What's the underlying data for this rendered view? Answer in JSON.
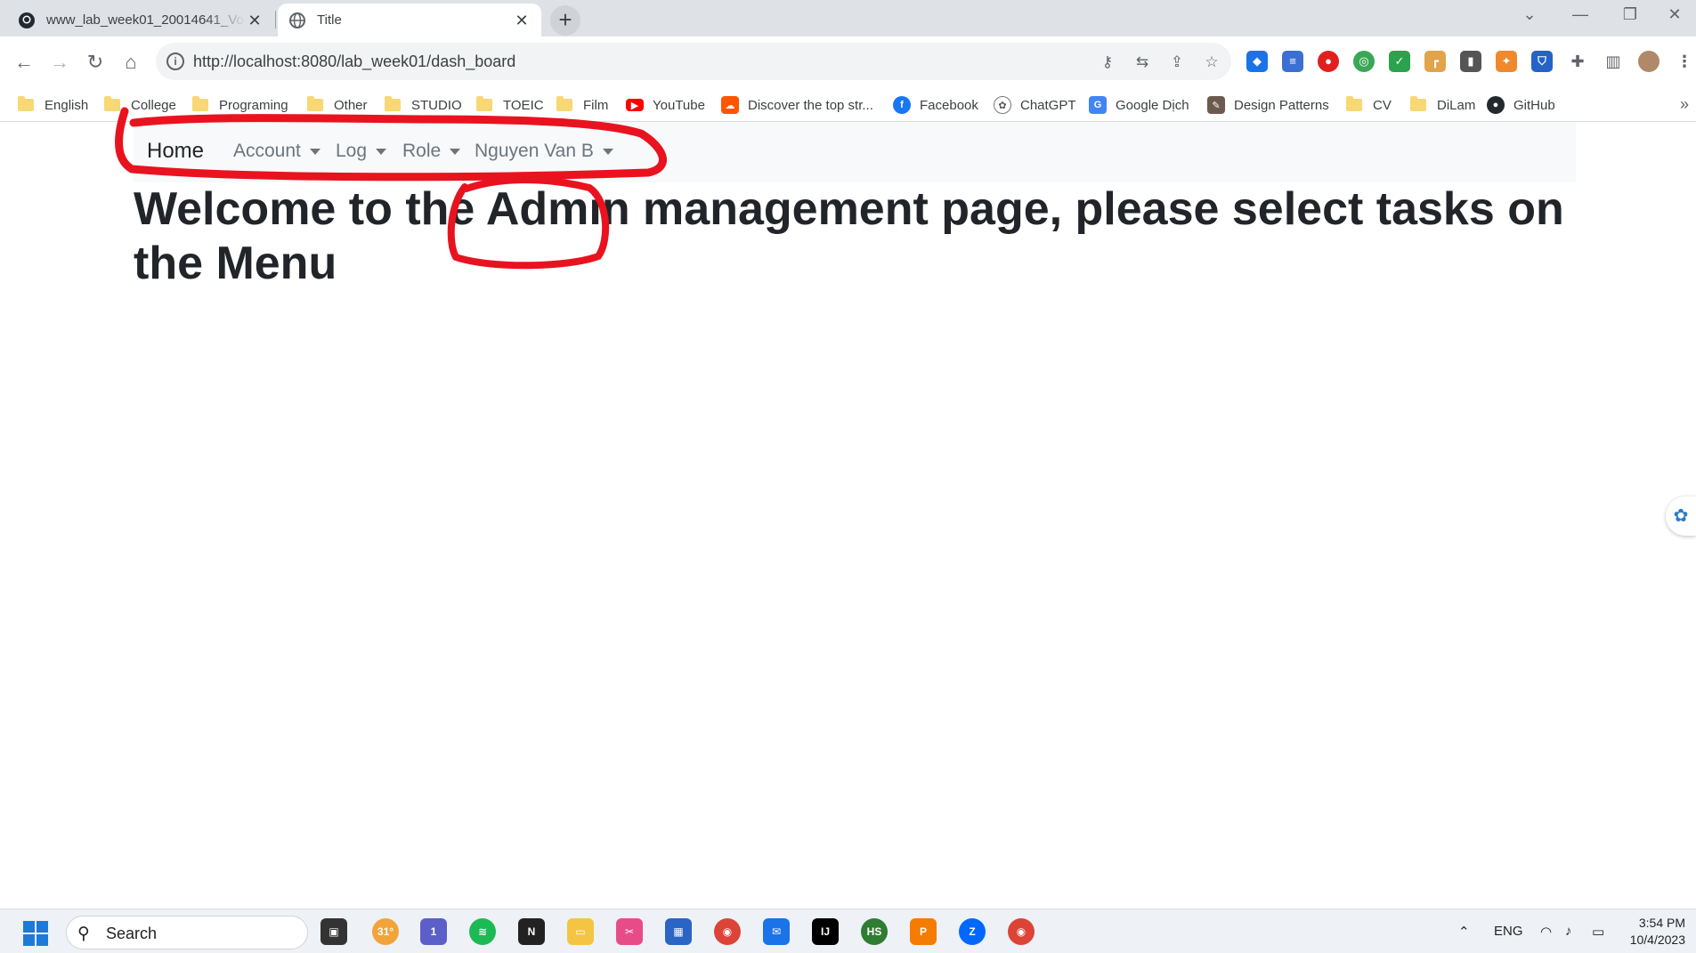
{
  "browser": {
    "tabs": [
      {
        "title": "www_lab_week01_20014641_Vo",
        "icon": "github-icon",
        "active": false
      },
      {
        "title": "Title",
        "icon": "globe-icon",
        "active": true
      }
    ],
    "new_tab_label": "+",
    "address_url": "http://localhost:8080/lab_week01/dash_board",
    "bookmarks": [
      {
        "label": "English",
        "icon": "folder-icon"
      },
      {
        "label": "College",
        "icon": "folder-icon"
      },
      {
        "label": "Programing",
        "icon": "folder-icon"
      },
      {
        "label": "Other",
        "icon": "folder-icon"
      },
      {
        "label": "STUDIO",
        "icon": "folder-icon"
      },
      {
        "label": "TOEIC",
        "icon": "folder-icon"
      },
      {
        "label": "Film",
        "icon": "folder-icon"
      },
      {
        "label": "YouTube",
        "icon": "youtube-icon"
      },
      {
        "label": "Discover the top str...",
        "icon": "soundcloud-icon"
      },
      {
        "label": "Facebook",
        "icon": "facebook-icon"
      },
      {
        "label": "ChatGPT",
        "icon": "chatgpt-icon"
      },
      {
        "label": "Google Dịch",
        "icon": "google-translate-icon"
      },
      {
        "label": "Design Patterns",
        "icon": "design-patterns-icon"
      },
      {
        "label": "CV",
        "icon": "folder-icon"
      },
      {
        "label": "DiLam",
        "icon": "folder-icon"
      },
      {
        "label": "GitHub",
        "icon": "github-icon"
      }
    ]
  },
  "navbar": {
    "home": "Home",
    "items": [
      {
        "label": "Account"
      },
      {
        "label": "Log"
      },
      {
        "label": "Role"
      },
      {
        "label": "Nguyen Van B"
      }
    ]
  },
  "main": {
    "heading": "Welcome to the Admin management page, please select tasks on the Menu"
  },
  "annotation": {
    "color": "#e8131f"
  },
  "taskbar": {
    "search_label": "Search",
    "weather": "31°",
    "chat_badge": "1",
    "language": "ENG",
    "time": "3:54 PM",
    "date": "10/4/2023"
  },
  "colors": {
    "tabstrip": "#dee1e6",
    "navbar_bg": "#f8f9fa",
    "nav_link": "#6c757d",
    "heading": "#212529"
  }
}
